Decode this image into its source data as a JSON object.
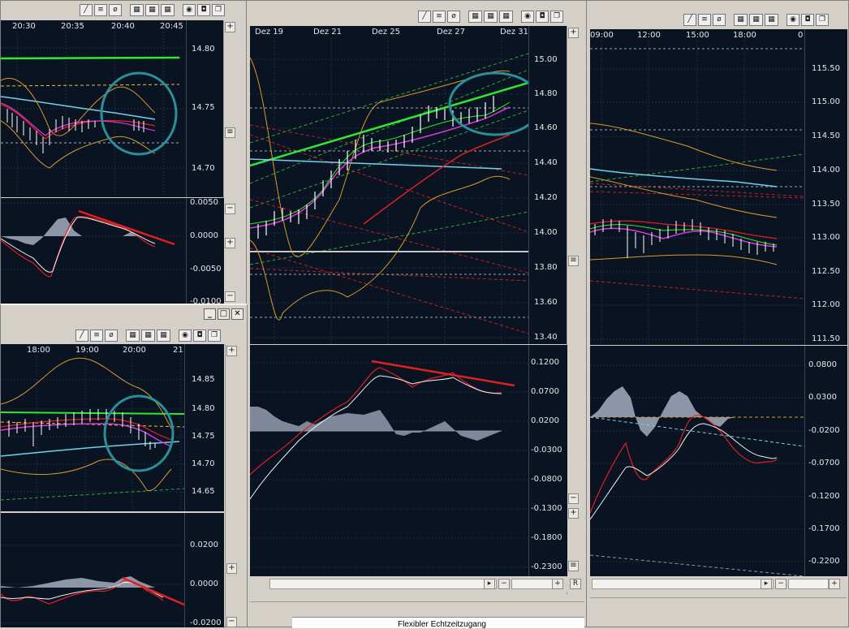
{
  "windows": {
    "top_left": {
      "time_labels": [
        "20:30",
        "20:35",
        "20:40",
        "20:45"
      ],
      "price_labels": [
        "14.80",
        "14.75",
        "14.70"
      ],
      "osc_labels": [
        "0.0050",
        "0.0000",
        "-0.0050",
        "-0.0100"
      ]
    },
    "center": {
      "time_labels": [
        "Dez 19",
        "Dez 21",
        "Dez 25",
        "Dez 27",
        "Dez 31"
      ],
      "price_labels": [
        "15.00",
        "14.80",
        "14.60",
        "14.40",
        "14.20",
        "14.00",
        "13.80",
        "13.60",
        "13.40"
      ],
      "osc_labels": [
        "0.1200",
        "0.0700",
        "0.0200",
        "-0.0300",
        "-0.0800",
        "-0.1300",
        "-0.1800",
        "-0.2300"
      ],
      "scroll_r_label": "R"
    },
    "right": {
      "time_labels": [
        "09:00",
        "12:00",
        "15:00",
        "18:00",
        "0"
      ],
      "price_labels": [
        "115.50",
        "115.00",
        "114.50",
        "114.00",
        "113.50",
        "113.00",
        "112.50",
        "112.00",
        "111.50"
      ],
      "osc_labels": [
        "0.0800",
        "0.0300",
        "-0.0200",
        "-0.0700",
        "-0.1200",
        "-0.1700",
        "-0.2200"
      ]
    },
    "bottom_left": {
      "time_labels": [
        "18:00",
        "19:00",
        "20:00",
        "21"
      ],
      "price_labels": [
        "14.85",
        "14.80",
        "14.75",
        "14.70",
        "14.65"
      ],
      "osc_labels": [
        "0.0200",
        "0.0000",
        "-0.0200"
      ]
    }
  },
  "toolbar_icons": [
    "draw-line-icon",
    "fibonacci-icon",
    "crosshair-icon",
    "grid-view-icon",
    "table-view-icon",
    "list-view-icon",
    "zoom-icon",
    "properties-icon",
    "restore-icon"
  ],
  "taskbar": {
    "text": "Flexibler Echtzeitzugang"
  },
  "colors": {
    "chart_bg": "#0a1322",
    "grid": "#1e2b44",
    "price_line": "#ffffff",
    "upper_band": "#d89a2a",
    "trend_green": "#2fe82f",
    "ma_cyan": "#6fd3e8",
    "ma_magenta": "#d43ad4",
    "trend_red": "#e02020",
    "annotation_circle": "#2a8f99"
  }
}
